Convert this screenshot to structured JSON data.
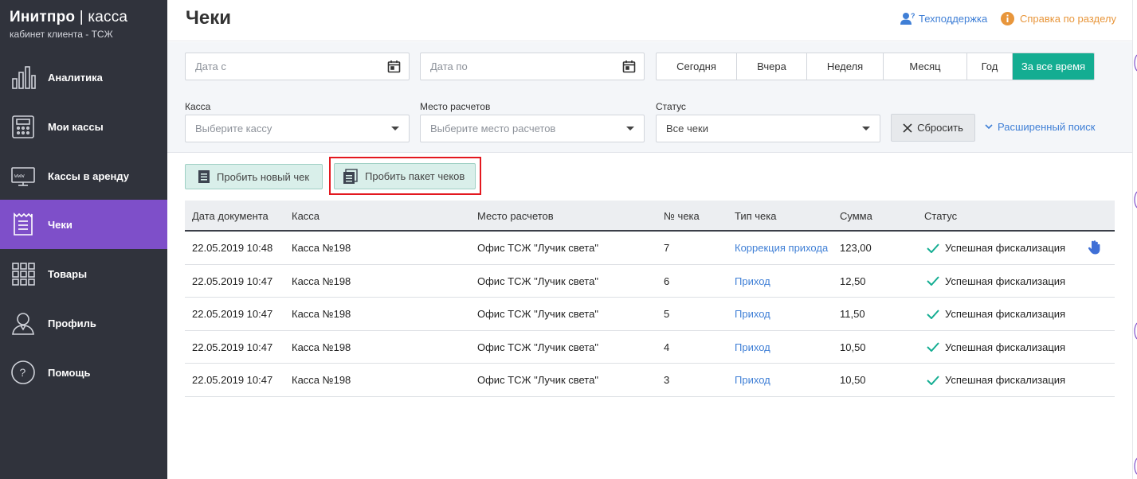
{
  "sidebar": {
    "brand_title": "Инитпро",
    "brand_suffix": "касса",
    "brand_sub": "кабинет клиента - ТСЖ",
    "items": [
      {
        "label": "Аналитика",
        "icon": "chart-icon"
      },
      {
        "label": "Мои кассы",
        "icon": "cash-register-icon"
      },
      {
        "label": "Кассы в аренду",
        "icon": "rent-terminal-icon"
      },
      {
        "label": "Чеки",
        "icon": "receipt-icon",
        "active": true
      },
      {
        "label": "Товары",
        "icon": "grid-icon"
      },
      {
        "label": "Профиль",
        "icon": "user-icon"
      },
      {
        "label": "Помощь",
        "icon": "question-icon"
      }
    ]
  },
  "header": {
    "title": "Чеки",
    "support": "Техподдержка",
    "help": "Справка по разделу"
  },
  "filters": {
    "date_from_placeholder": "Дата с",
    "date_to_placeholder": "Дата по",
    "periods": [
      "Сегодня",
      "Вчера",
      "Неделя",
      "Месяц",
      "Год",
      "За все время"
    ],
    "active_period": "За все время",
    "kassa_label": "Касса",
    "kassa_placeholder": "Выберите кассу",
    "place_label": "Место расчетов",
    "place_placeholder": "Выберите место расчетов",
    "status_label": "Статус",
    "status_value": "Все чеки",
    "reset": "Сбросить",
    "advanced": "Расширенный поиск"
  },
  "actions": {
    "new_receipt": "Пробить новый чек",
    "batch_receipts": "Пробить пакет чеков"
  },
  "table": {
    "columns": [
      "Дата документа",
      "Касса",
      "Место расчетов",
      "№ чека",
      "Тип чека",
      "Сумма",
      "Статус"
    ],
    "rows": [
      {
        "date": "22.05.2019 10:48",
        "kassa": "Касса №198",
        "place": "Офис ТСЖ \"Лучик света\"",
        "num": "7",
        "type": "Коррекция прихода",
        "sum": "123,00",
        "status": "Успешная фискализация"
      },
      {
        "date": "22.05.2019 10:47",
        "kassa": "Касса №198",
        "place": "Офис ТСЖ \"Лучик света\"",
        "num": "6",
        "type": "Приход",
        "sum": "12,50",
        "status": "Успешная фискализация"
      },
      {
        "date": "22.05.2019 10:47",
        "kassa": "Касса №198",
        "place": "Офис ТСЖ \"Лучик света\"",
        "num": "5",
        "type": "Приход",
        "sum": "11,50",
        "status": "Успешная фискализация"
      },
      {
        "date": "22.05.2019 10:47",
        "kassa": "Касса №198",
        "place": "Офис ТСЖ \"Лучик света\"",
        "num": "4",
        "type": "Приход",
        "sum": "10,50",
        "status": "Успешная фискализация"
      },
      {
        "date": "22.05.2019 10:47",
        "kassa": "Касса №198",
        "place": "Офис ТСЖ \"Лучик света\"",
        "num": "3",
        "type": "Приход",
        "sum": "10,50",
        "status": "Успешная фискализация"
      }
    ]
  },
  "colors": {
    "sidebar_bg": "#30333c",
    "active_nav": "#7e4fc9",
    "accent_green": "#14ad92",
    "link_blue": "#3f7fd6",
    "help_orange": "#e8963b",
    "highlight_red": "#e3181f"
  }
}
